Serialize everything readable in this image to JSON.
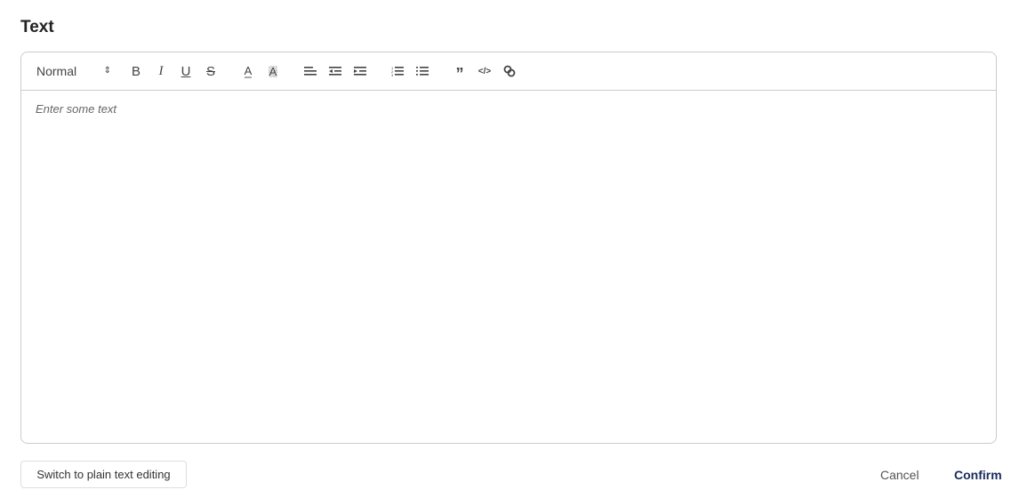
{
  "title": "Text",
  "toolbar": {
    "block_format": "Normal",
    "buttons": [
      "bold",
      "italic",
      "underline",
      "strikethrough",
      "text-color",
      "background-color",
      "align",
      "outdent",
      "indent",
      "ordered-list",
      "bullet-list",
      "blockquote",
      "code",
      "link"
    ]
  },
  "editor": {
    "placeholder": "Enter some text"
  },
  "footer": {
    "switch_label": "Switch to plain text editing",
    "cancel_label": "Cancel",
    "confirm_label": "Confirm"
  }
}
